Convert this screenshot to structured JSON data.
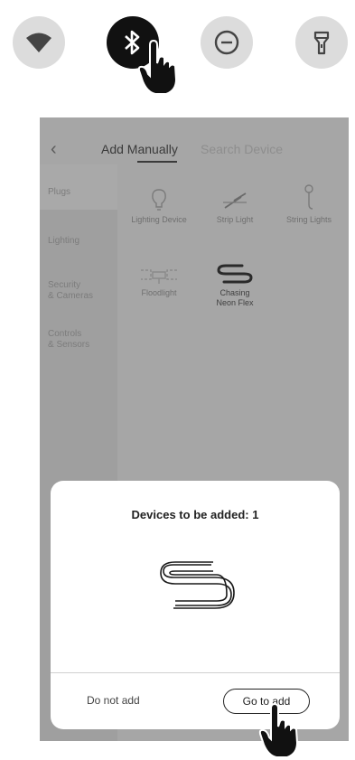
{
  "quick_settings": {
    "icons": [
      "wifi-icon",
      "bluetooth-icon",
      "do-not-disturb-icon",
      "flashlight-icon"
    ]
  },
  "app": {
    "tabs": {
      "active": "Add Manually",
      "inactive": "Search Device"
    },
    "categories": [
      "Plugs",
      "Lighting",
      "Security\n& Cameras",
      "Controls\n& Sensors"
    ],
    "devices": [
      "Lighting Device",
      "Strip Light",
      "String Lights",
      "Floodlight",
      "Chasing\nNeon Flex"
    ]
  },
  "dialog": {
    "title": "Devices to be added: 1",
    "cancel_label": "Do not add",
    "confirm_label": "Go to add"
  }
}
